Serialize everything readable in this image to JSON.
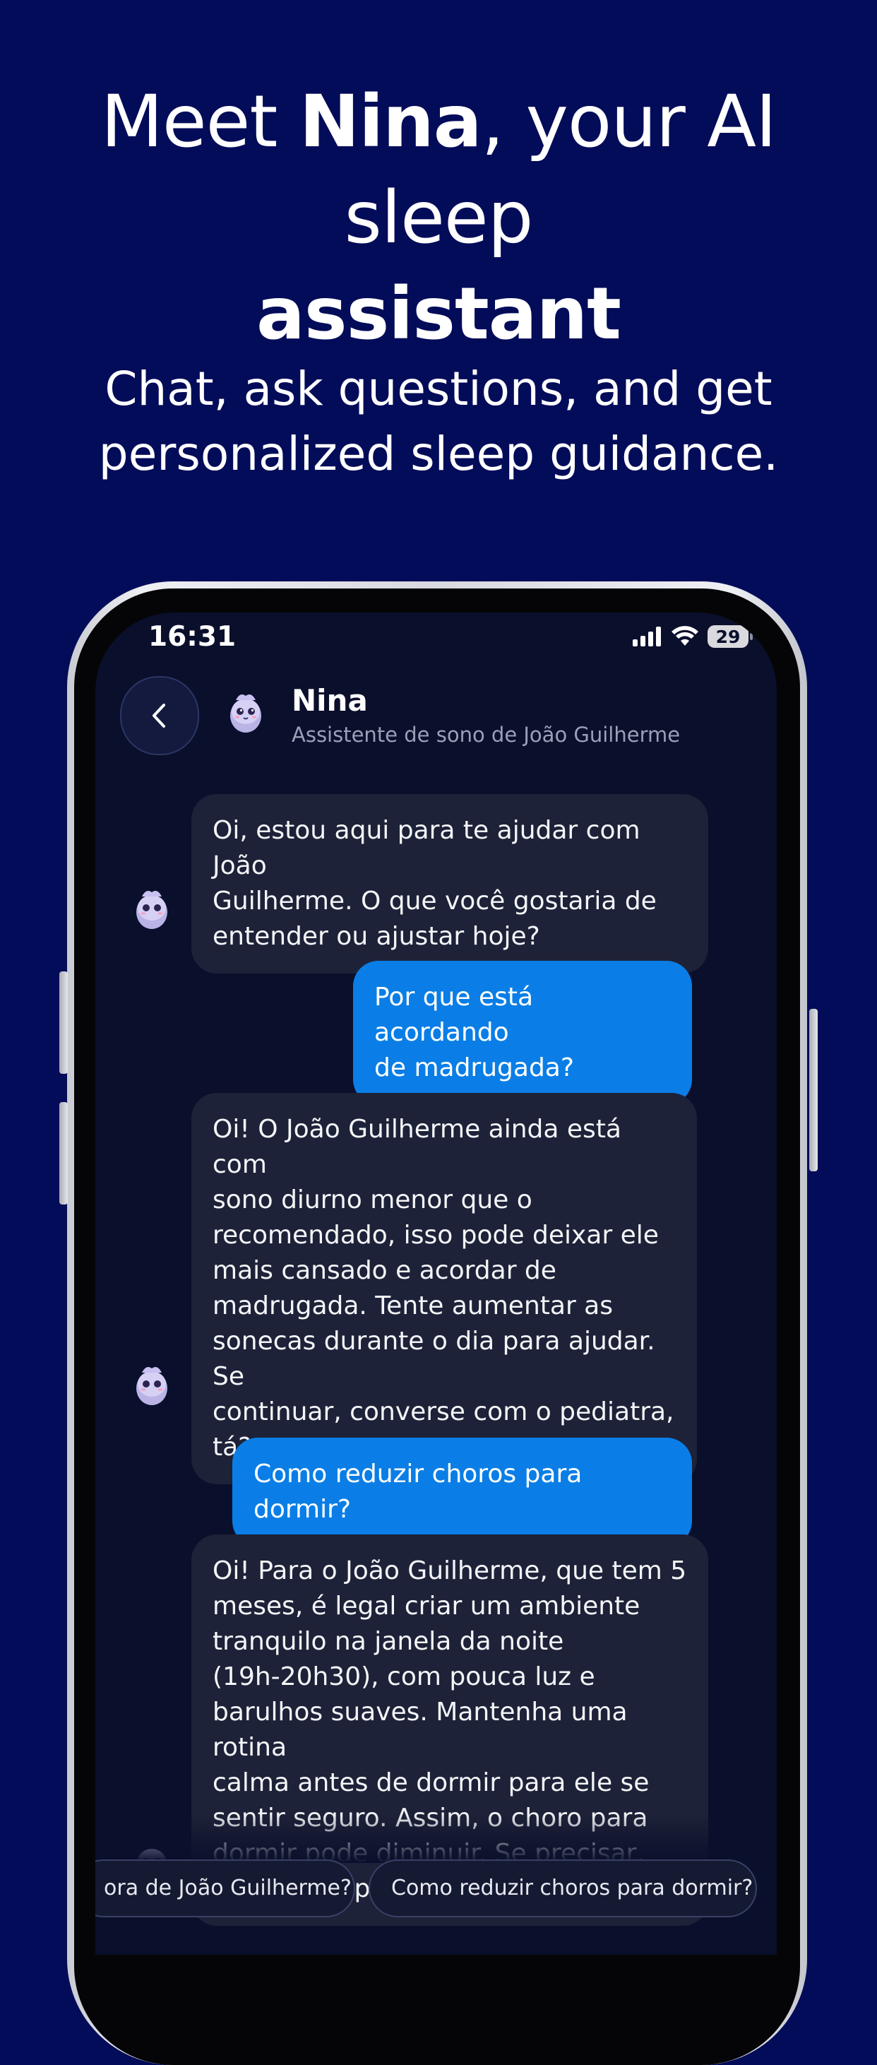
{
  "promo": {
    "headline_pre": "Meet ",
    "headline_name": "Nina",
    "headline_mid": ", your AI sleep",
    "headline_bold_end": "assistant",
    "subtitle_line1": "Chat, ask questions, and get",
    "subtitle_line2": "personalized sleep guidance."
  },
  "status_bar": {
    "time": "16:31",
    "battery": "29"
  },
  "chat_header": {
    "name": "Nina",
    "subtitle": "Assistente de sono de João Guilherme"
  },
  "messages": [
    {
      "from": "bot",
      "text": "Oi, estou aqui para te ajudar com João\nGuilherme. O que você gostaria de\nentender ou ajustar hoje?"
    },
    {
      "from": "user",
      "text": "Por que está acordando\nde madrugada?"
    },
    {
      "from": "bot",
      "text": "Oi! O João Guilherme ainda está com\nsono diurno menor que o\nrecomendado, isso pode deixar ele\nmais cansado e acordar de\nmadrugada. Tente aumentar as\nsonecas durante o dia para ajudar. Se\ncontinuar, converse com o pediatra,\ntá?"
    },
    {
      "from": "user",
      "text": "Como reduzir choros para dormir?"
    },
    {
      "from": "bot",
      "text": "Oi! Para o João Guilherme, que tem 5\nmeses, é legal criar um ambiente\ntranquilo na janela da noite\n(19h-20h30), com pouca luz e\nbarulhos suaves. Mantenha uma rotina\ncalma antes de dormir para ele se\nsentir seguro. Assim, o choro para\ndormir pode diminuir. Se precisar,\nestou aqui para ajudar!"
    }
  ],
  "suggestions": [
    "ora de João Guilherme?",
    "Como reduzir choros para dormir?"
  ],
  "colors": {
    "background": "#030c59",
    "screen": "#0a0f2b",
    "bot_bubble": "#1d2238",
    "user_bubble": "#0a7ee6"
  },
  "icons": [
    "back-chevron-icon",
    "nina-mascot-icon",
    "signal-icon",
    "wifi-icon",
    "battery-icon"
  ]
}
